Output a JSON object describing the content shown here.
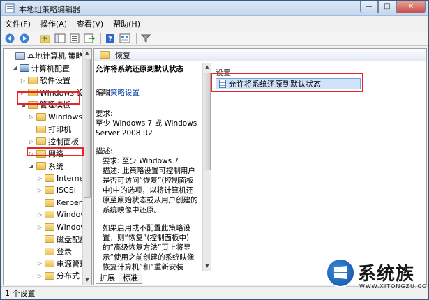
{
  "window": {
    "title": "本地组策略编辑器"
  },
  "menu": [
    "文件(F)",
    "操作(A)",
    "查看(V)",
    "帮助(H)"
  ],
  "tree": [
    {
      "label": "本地计算机 策略",
      "expander": ""
    },
    {
      "label": "计算机配置",
      "expander": "◢"
    },
    {
      "label": "软件设置",
      "expander": "▷"
    },
    {
      "label": "Windows 设置",
      "expander": "▷"
    },
    {
      "label": "管理模板",
      "expander": "◢"
    },
    {
      "label": "Windows",
      "expander": "▷"
    },
    {
      "label": "打印机",
      "expander": ""
    },
    {
      "label": "控制面板",
      "expander": "▷"
    },
    {
      "label": "网络",
      "expander": "▷"
    },
    {
      "label": "系统",
      "expander": "◢"
    },
    {
      "label": "Internet",
      "expander": "▷"
    },
    {
      "label": "iSCSI",
      "expander": "▷"
    },
    {
      "label": "Kerberos",
      "expander": ""
    },
    {
      "label": "Windows",
      "expander": "▷"
    },
    {
      "label": "Windows",
      "expander": "▷"
    },
    {
      "label": "磁盘配额",
      "expander": ""
    },
    {
      "label": "登录",
      "expander": ""
    },
    {
      "label": "电源管理",
      "expander": "▷"
    },
    {
      "label": "分布式",
      "expander": "▷"
    }
  ],
  "header": {
    "folder_name": "恢复"
  },
  "description": {
    "title": "允许将系统还原到默认状态",
    "edit_prefix": "编辑",
    "edit_link": "策略设置",
    "req_label": "要求:",
    "req_text": "至少 Windows 7 或 Windows Server 2008 R2",
    "desc_label": "描述:",
    "desc_req": "要求: 至少 Windows 7",
    "desc_text": "描述: 此策略设置可控制用户是否可访问“恢复”(控制面板中)中的选项，以将计算机还原至原始状态或从用户创建的系统映像中还原。",
    "para2": "如果启用或不配置此策略设置，则“恢复”(控制面板中)的“高级恢复方法”页上将显示“使用之前创建的系统映像恢复计算机”和“重新安装 Windows”(或“将计算机还原至出厂状态”)选项。"
  },
  "list": {
    "column_header": "设置",
    "items": [
      "允许将系统还原到默认状态"
    ]
  },
  "tabs": [
    "扩展",
    "标准"
  ],
  "status": "1 个设置",
  "watermark": {
    "text": "系统族",
    "url": "WWW.XITONGZU.COM"
  }
}
